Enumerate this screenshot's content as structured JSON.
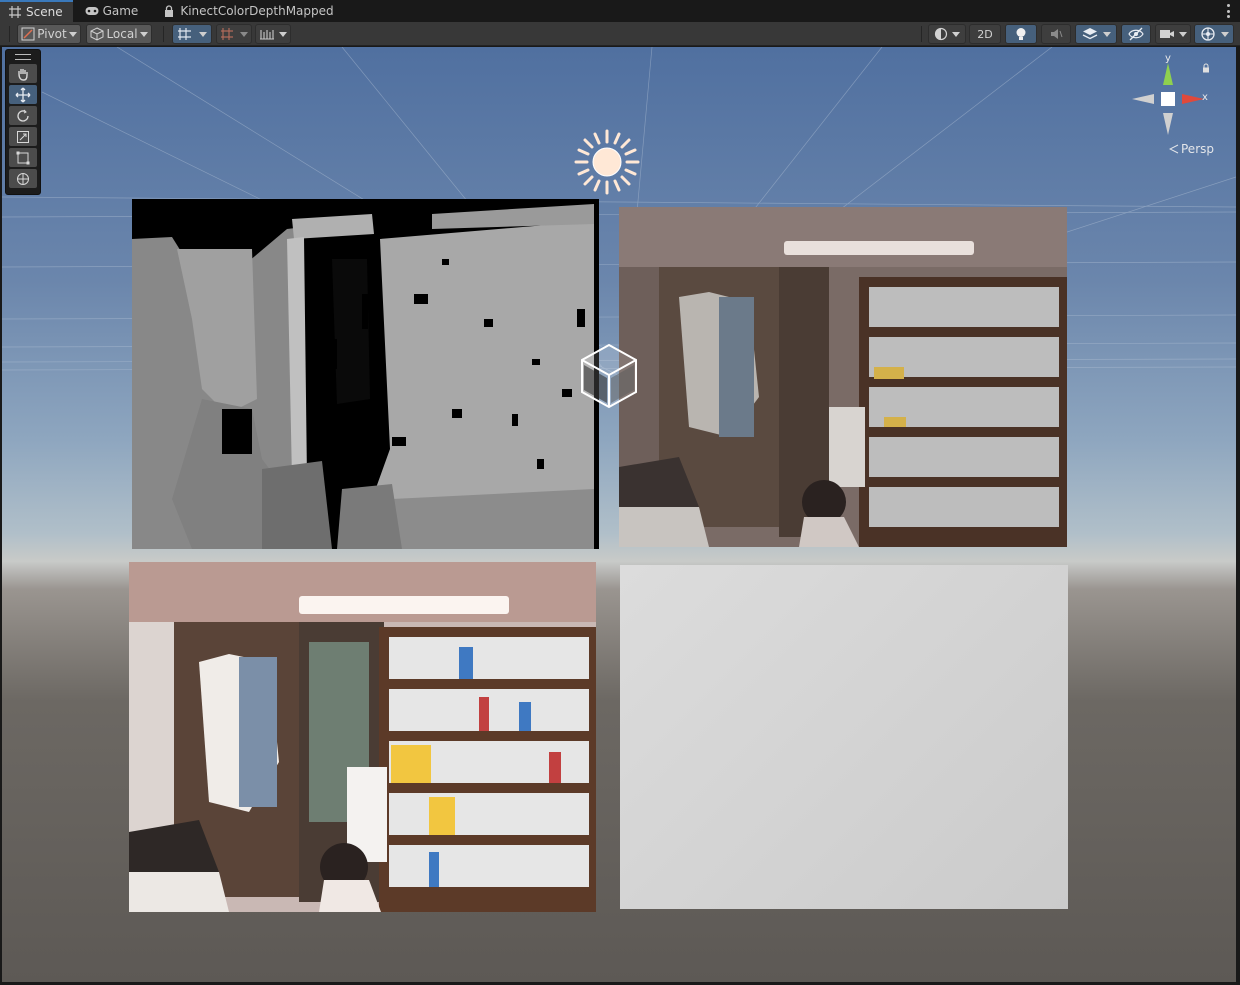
{
  "tabs": [
    {
      "label": "Scene",
      "icon": "grid-icon",
      "active": true
    },
    {
      "label": "Game",
      "icon": "gamepad-icon",
      "active": false
    },
    {
      "label": "KinectColorDepthMapped",
      "icon": "lock-icon",
      "active": false
    }
  ],
  "toolbar": {
    "pivot_label": "Pivot",
    "local_label": "Local",
    "mode_2d_label": "2D"
  },
  "tools": [
    "hand-icon",
    "move-icon",
    "rotate-icon",
    "scale-icon",
    "rect-icon",
    "transform-icon"
  ],
  "gizmo": {
    "y_label": "y",
    "x_label": "x",
    "persp_label": "Persp"
  },
  "scene": {
    "panels": [
      "depth-image-panel",
      "mapped-color-image-panel",
      "color-image-panel",
      "blank-white-panel"
    ]
  },
  "colors": {
    "accent": "#3a79bb",
    "active_button": "#46607c",
    "sky_top": "#5070a0",
    "ground": "#5d5955",
    "gizmo_y": "#8fd14f",
    "gizmo_x": "#e0493b"
  }
}
